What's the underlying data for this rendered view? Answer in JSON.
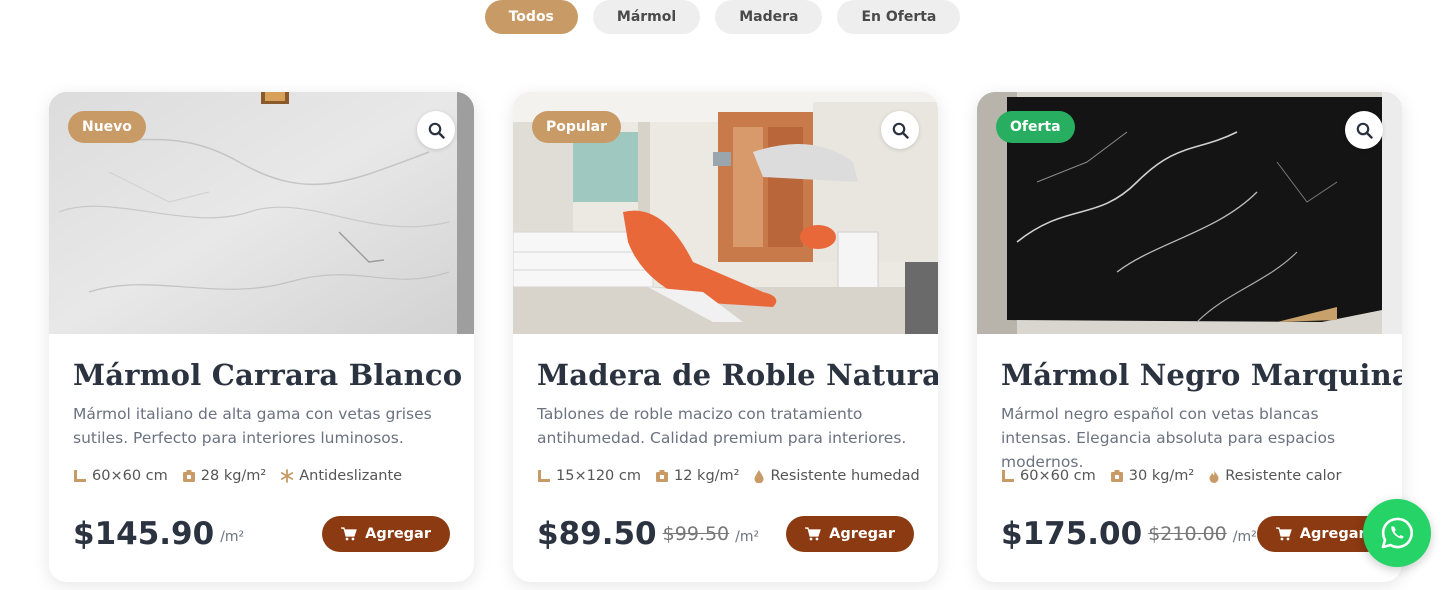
{
  "filters": [
    "Todos",
    "Mármol",
    "Madera",
    "En Oferta"
  ],
  "colors": {
    "accent": "#c89a66",
    "button": "#8b3a11",
    "offer_badge": "#27ae60",
    "whatsapp": "#25d366"
  },
  "products": [
    {
      "badge": "Nuevo",
      "title": "Mármol Carrara Blanco",
      "description": "Mármol italiano de alta gama con vetas grises sutiles. Perfecto para interiores luminosos.",
      "specs": [
        "60×60 cm",
        "28 kg/m²",
        "Antideslizante"
      ],
      "spec_icons": [
        "ruler-icon",
        "weight-icon",
        "snowflake-icon"
      ],
      "price": "$145.90",
      "old_price": "",
      "unit": "/m²",
      "add_label": "Agregar"
    },
    {
      "badge": "Popular",
      "title": "Madera de Roble Natural",
      "description": "Tablones de roble macizo con tratamiento antihumedad. Calidad premium para interiores.",
      "specs": [
        "15×120 cm",
        "12 kg/m²",
        "Resistente humedad"
      ],
      "spec_icons": [
        "ruler-icon",
        "weight-icon",
        "droplet-icon"
      ],
      "price": "$89.50",
      "old_price": "$99.50",
      "unit": "/m²",
      "add_label": "Agregar"
    },
    {
      "badge": "Oferta",
      "title": "Mármol Negro Marquina",
      "description": "Mármol negro español con vetas blancas intensas. Elegancia absoluta para espacios modernos.",
      "specs": [
        "60×60 cm",
        "30 kg/m²",
        "Resistente calor"
      ],
      "spec_icons": [
        "ruler-icon",
        "weight-icon",
        "flame-icon"
      ],
      "price": "$175.00",
      "old_price": "$210.00",
      "unit": "/m²",
      "add_label": "Agregar"
    }
  ]
}
